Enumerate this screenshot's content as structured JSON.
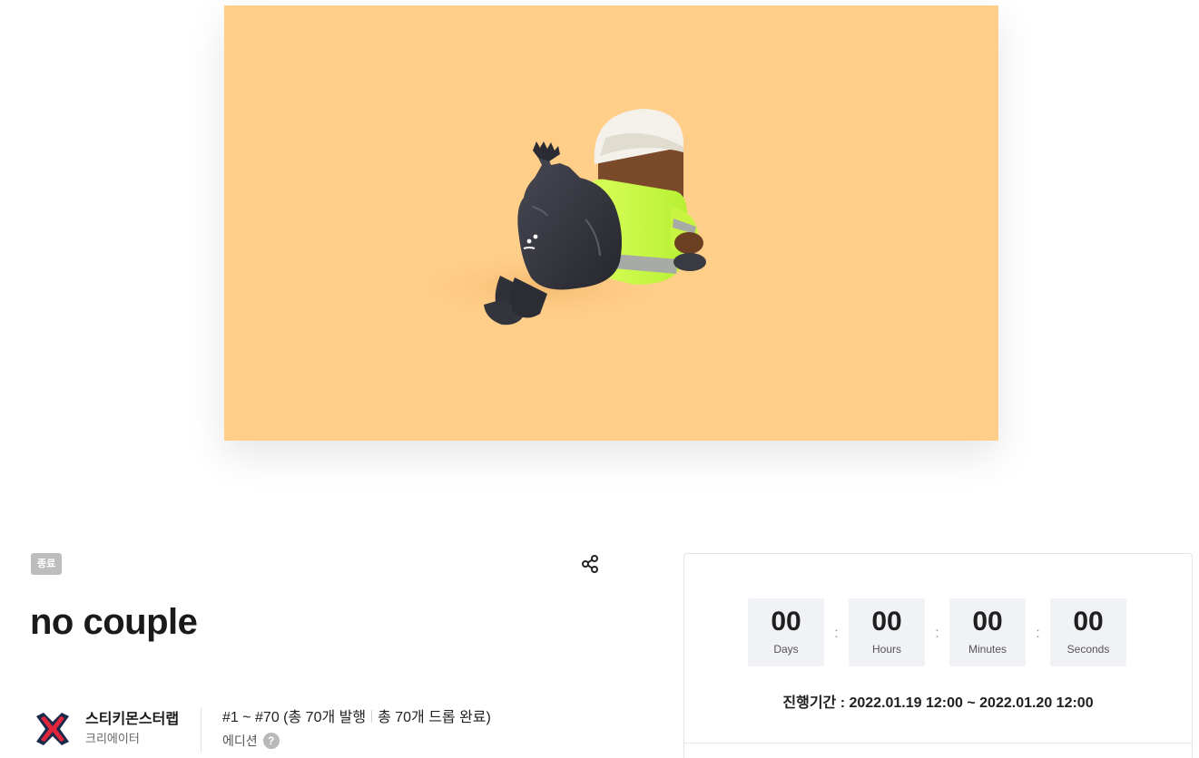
{
  "drop": {
    "status": "종료",
    "title": "no couple"
  },
  "creator": {
    "name": "스티키몬스터랩",
    "role": "크리에이터"
  },
  "edition": {
    "range": "#1 ~ #70 (총 70개 발행",
    "dropped": "총 70개 드롭 완료)",
    "type": "에디션",
    "help": "?"
  },
  "countdown": {
    "items": [
      {
        "value": "00",
        "label": "Days"
      },
      {
        "value": "00",
        "label": "Hours"
      },
      {
        "value": "00",
        "label": "Minutes"
      },
      {
        "value": "00",
        "label": "Seconds"
      }
    ],
    "colon": ":",
    "period": "진행기간 : 2022.01.19 12:00 ~ 2022.01.20 12:00"
  },
  "icons": {
    "share": "share-icon",
    "avatar": "creator-x-logo-icon",
    "help": "help-circle-icon"
  },
  "colors": {
    "hero_background": "#ffce89",
    "badge_background": "#bdbdbd",
    "countdown_box": "#f0f2f5",
    "logo_navy": "#1c2a4a",
    "logo_red": "#e2253a"
  }
}
